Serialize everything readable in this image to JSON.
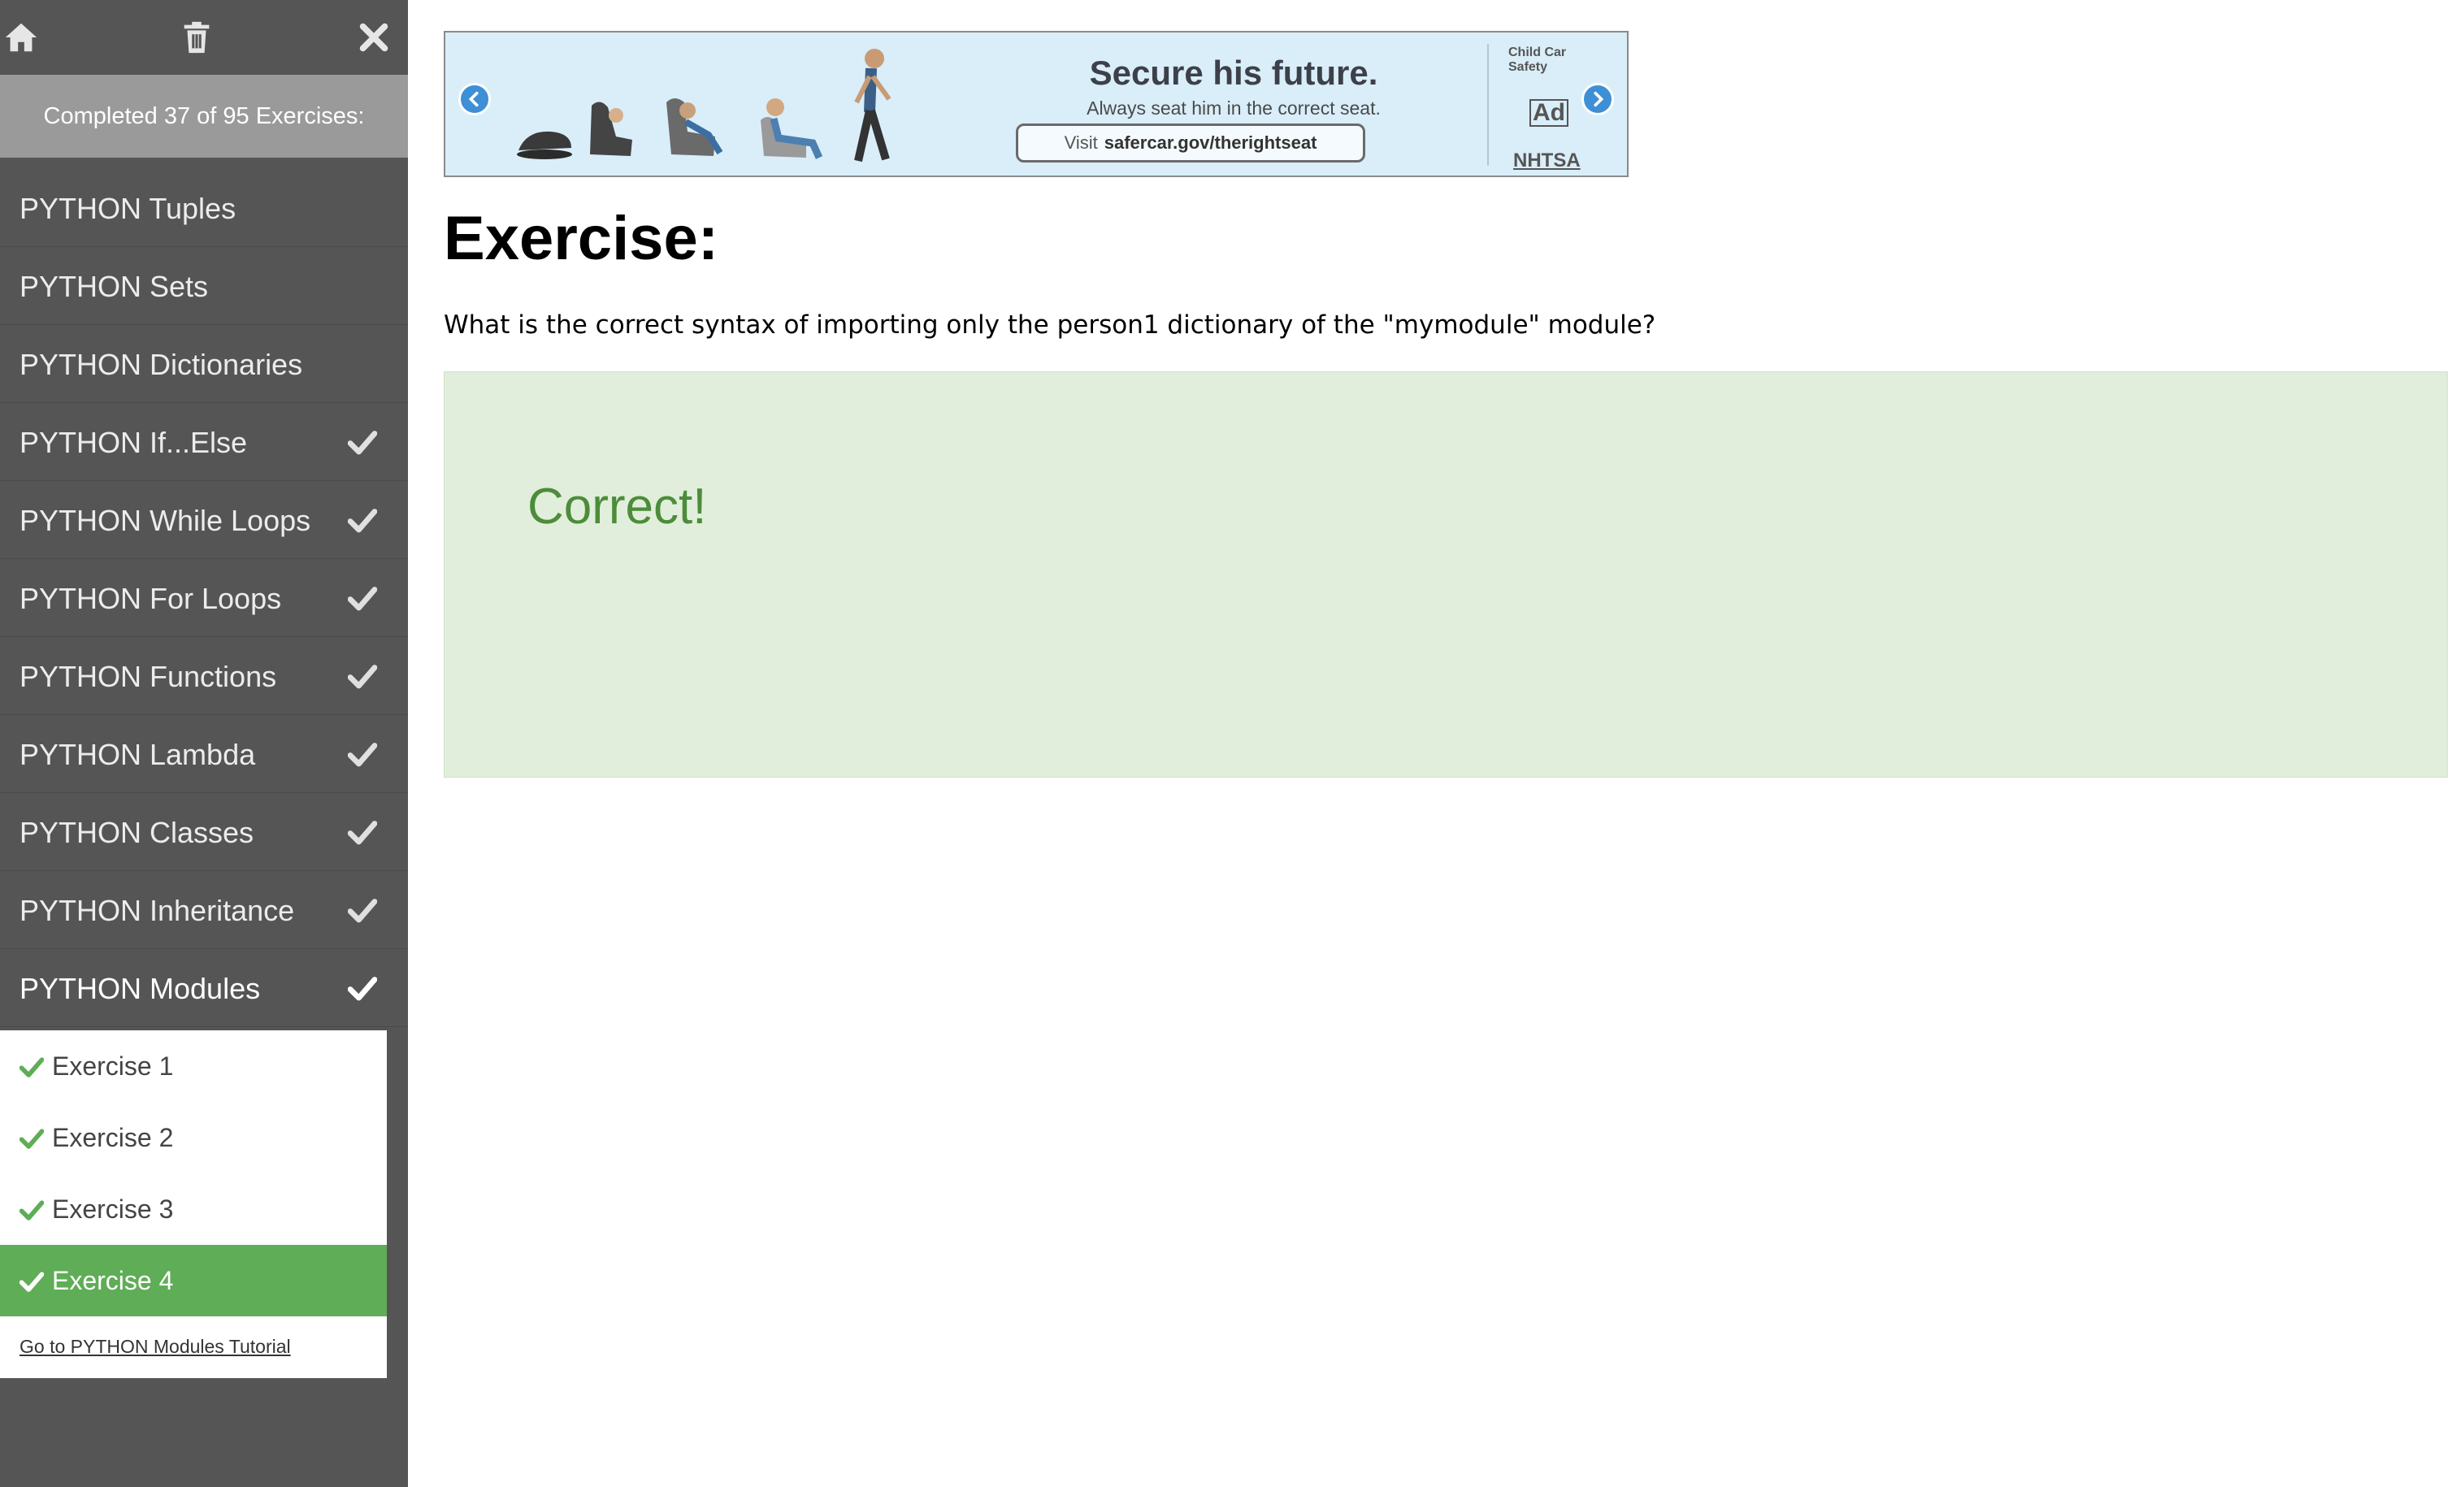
{
  "toolbar": {
    "home_icon": "home-icon",
    "trash_icon": "trash-icon",
    "close_icon": "close-icon"
  },
  "progress": {
    "text": "Completed 37 of 95 Exercises:",
    "completed": 37,
    "total": 95
  },
  "topics": [
    {
      "label": "PYTHON Tuples",
      "done": false
    },
    {
      "label": "PYTHON Sets",
      "done": false
    },
    {
      "label": "PYTHON Dictionaries",
      "done": false
    },
    {
      "label": "PYTHON If...Else",
      "done": true
    },
    {
      "label": "PYTHON While Loops",
      "done": true
    },
    {
      "label": "PYTHON For Loops",
      "done": true
    },
    {
      "label": "PYTHON Functions",
      "done": true
    },
    {
      "label": "PYTHON Lambda",
      "done": true
    },
    {
      "label": "PYTHON Classes",
      "done": true
    },
    {
      "label": "PYTHON Inheritance",
      "done": true
    },
    {
      "label": "PYTHON Modules",
      "done": true,
      "active": true
    }
  ],
  "exercises": [
    {
      "label": "Exercise 1",
      "done": true
    },
    {
      "label": "Exercise 2",
      "done": true
    },
    {
      "label": "Exercise 3",
      "done": true
    },
    {
      "label": "Exercise 4",
      "done": true,
      "current": true
    }
  ],
  "tutorial_link": "Go to PYTHON Modules Tutorial",
  "ad": {
    "title": "Secure his future.",
    "subtitle": "Always seat him in the correct seat.",
    "cta_prefix": "Visit",
    "cta_url": "safercar.gov/therightseat",
    "logo_child_car": "Child Car Safety",
    "logo_ad_council": "Ad Council",
    "logo_nhtsa": "NHTSA"
  },
  "main": {
    "title": "Exercise:",
    "question": "What is the correct syntax of importing only the person1 dictionary of the \"mymodule\" module?",
    "result": "Correct!"
  },
  "colors": {
    "sidebar_bg": "#555555",
    "progress_bg": "#9a9a9a",
    "accent_green": "#5fad56",
    "result_bg": "#e1eedb",
    "result_text": "#4c8c3a"
  }
}
